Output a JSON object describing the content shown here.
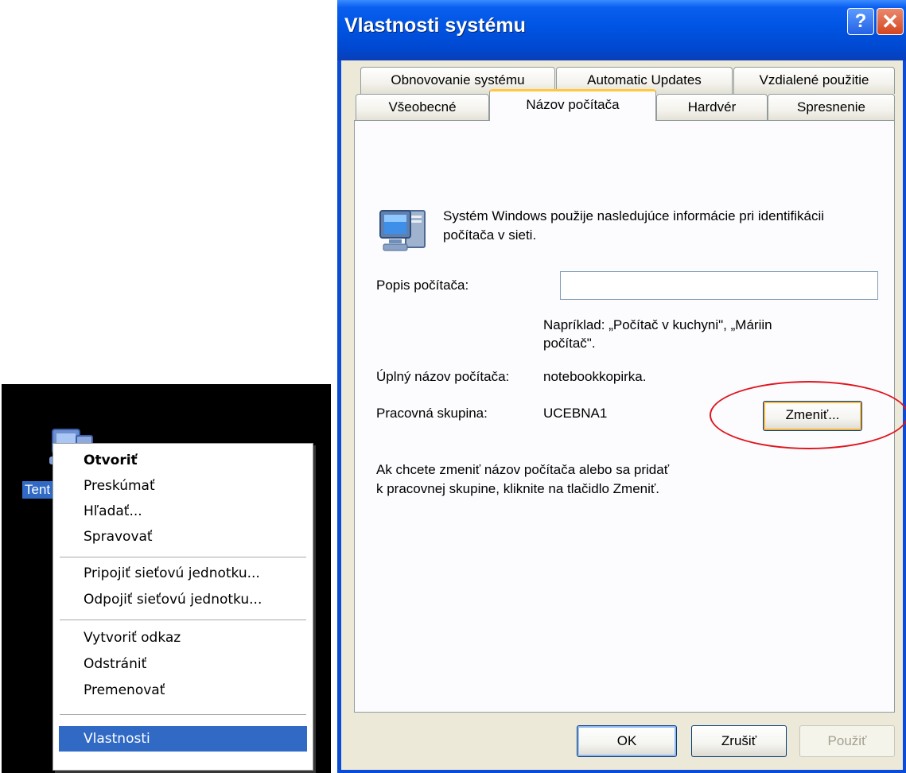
{
  "desktop": {
    "icon_label": "Tent"
  },
  "context_menu": {
    "items": [
      {
        "label": "Otvoriť"
      },
      {
        "label": "Preskúmať"
      },
      {
        "label": "Hľadať..."
      },
      {
        "label": "Spravovať"
      },
      {
        "label": "Pripojiť sieťovú jednotku..."
      },
      {
        "label": "Odpojiť sieťovú jednotku..."
      },
      {
        "label": "Vytvoriť odkaz"
      },
      {
        "label": "Odstrániť"
      },
      {
        "label": "Premenovať"
      },
      {
        "label": "Vlastnosti"
      }
    ]
  },
  "dialog": {
    "title": "Vlastnosti systému",
    "help_glyph": "?",
    "close_glyph": "✕",
    "tabs_row1": [
      {
        "label": "Obnovovanie systému"
      },
      {
        "label": "Automatic Updates"
      },
      {
        "label": "Vzdialené použitie"
      }
    ],
    "tabs_row2": [
      {
        "label": "Všeobecné"
      },
      {
        "label": "Názov počítača"
      },
      {
        "label": "Hardvér"
      },
      {
        "label": "Spresnenie"
      }
    ],
    "info_line1": "Systém Windows použije nasledujúce informácie pri identifikácii",
    "info_line2": "počítača v sieti.",
    "description_label": "Popis počítača:",
    "description_value": "",
    "example_line1": "Napríklad: „Počítač v kuchyni\", „Máriin",
    "example_line2": "počítač\".",
    "full_name_label": "Úplný názov počítača:",
    "full_name_value": "notebookkopirka.",
    "workgroup_label": "Pracovná skupina:",
    "workgroup_value": "UCEBNA1",
    "change_text_line1": "Ak chcete zmeniť názov počítača alebo sa pridať",
    "change_text_line2": "k pracovnej skupine, kliknite na tlačidlo Zmeniť.",
    "change_button": "Zmeniť...",
    "ok_button": "OK",
    "cancel_button": "Zrušiť",
    "apply_button": "Použiť"
  },
  "colors": {
    "titlebar_blue": "#0054e3",
    "menu_highlight": "#316ac5",
    "dialog_face": "#ece9d8",
    "annotation_red": "#e0141e"
  }
}
